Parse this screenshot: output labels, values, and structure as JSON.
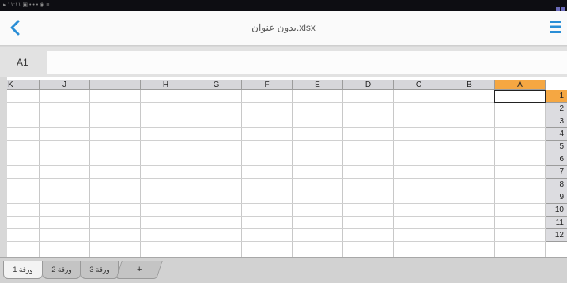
{
  "status_bar": {
    "left_text": "▸ ١١:١١ ▣ • • • ◉ ≡"
  },
  "header": {
    "title": "بدون عنوان.xlsx",
    "back_icon": "chevron-left-icon",
    "menu_icon": "hamburger-menu-icon"
  },
  "formula_bar": {
    "cell_reference": "A1",
    "value": ""
  },
  "grid": {
    "columns": [
      "K",
      "J",
      "I",
      "H",
      "G",
      "F",
      "E",
      "D",
      "C",
      "B",
      "A"
    ],
    "rows": [
      "1",
      "2",
      "3",
      "4",
      "5",
      "6",
      "7",
      "8",
      "9",
      "10",
      "11",
      "12"
    ],
    "active_column": "A",
    "active_row": "1"
  },
  "tabs": [
    {
      "label": "ورقة 1",
      "active": true
    },
    {
      "label": "ورقة 2",
      "active": false
    },
    {
      "label": "ورقة 3",
      "active": false
    }
  ],
  "add_tab_label": "+",
  "colors": {
    "accent": "#f5a742",
    "back_icon": "#2a8ed6",
    "menu_icon": "#2a8ed6",
    "status_bar": "#0d0d12"
  }
}
